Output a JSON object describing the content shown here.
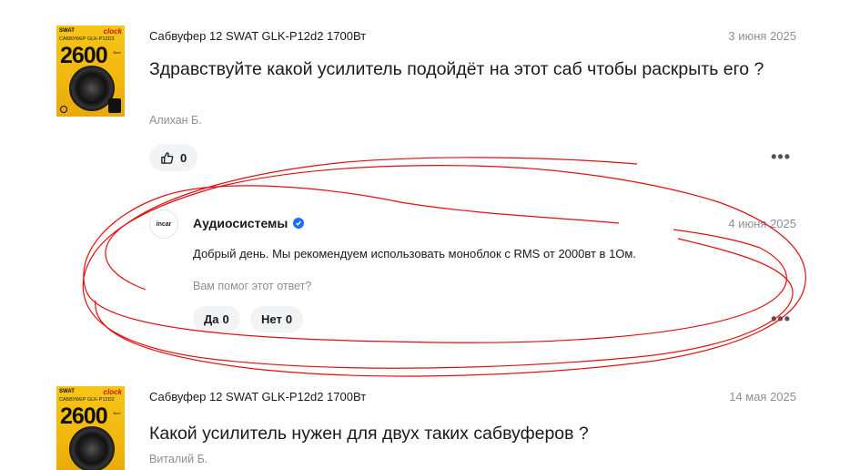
{
  "questions": [
    {
      "thumbnail": {
        "brand": "SWAT",
        "series": "clock",
        "subtitle": "САБВУФЕР GLK-P12D2",
        "power": "2600",
        "unit": "Ватт"
      },
      "product": "Сабвуфер 12 SWAT GLK-P12d2 1700Вт",
      "date": "3 июня 2025",
      "text": "Здравствуйте какой усилитель подойдёт на этот саб чтобы раскрыть его ?",
      "author": "Алихан Б.",
      "likes": "0",
      "like_icon": "thumbs-up-icon",
      "more": "•••",
      "answer": {
        "avatar_text": "incar",
        "seller": "Аудиосистемы",
        "verified_icon": "verified-check-icon",
        "date": "4 июня 2025",
        "text": "Добрый день. Мы рекомендуем использовать моноблок с RMS от 2000вт в 1Ом.",
        "helped_prompt": "Вам помог этот ответ?",
        "yes_label": "Да",
        "yes_count": "0",
        "no_label": "Нет",
        "no_count": "0",
        "more": "•••"
      }
    },
    {
      "thumbnail": {
        "brand": "SWAT",
        "series": "clock",
        "subtitle": "САБВУФЕР GLK-P12D2",
        "power": "2600",
        "unit": "Ватт"
      },
      "product": "Сабвуфер 12 SWAT GLK-P12d2 1700Вт",
      "date": "14 мая 2025",
      "text": "Какой усилитель нужен для двух таких сабвуферов ?",
      "author": "Виталий Б."
    }
  ],
  "colors": {
    "annotation": "#e01010",
    "muted_text": "#8a8f99",
    "pill_bg": "#f2f3f5",
    "verified": "#1a6ff0",
    "thumb_yellow": "#f2b70c"
  }
}
